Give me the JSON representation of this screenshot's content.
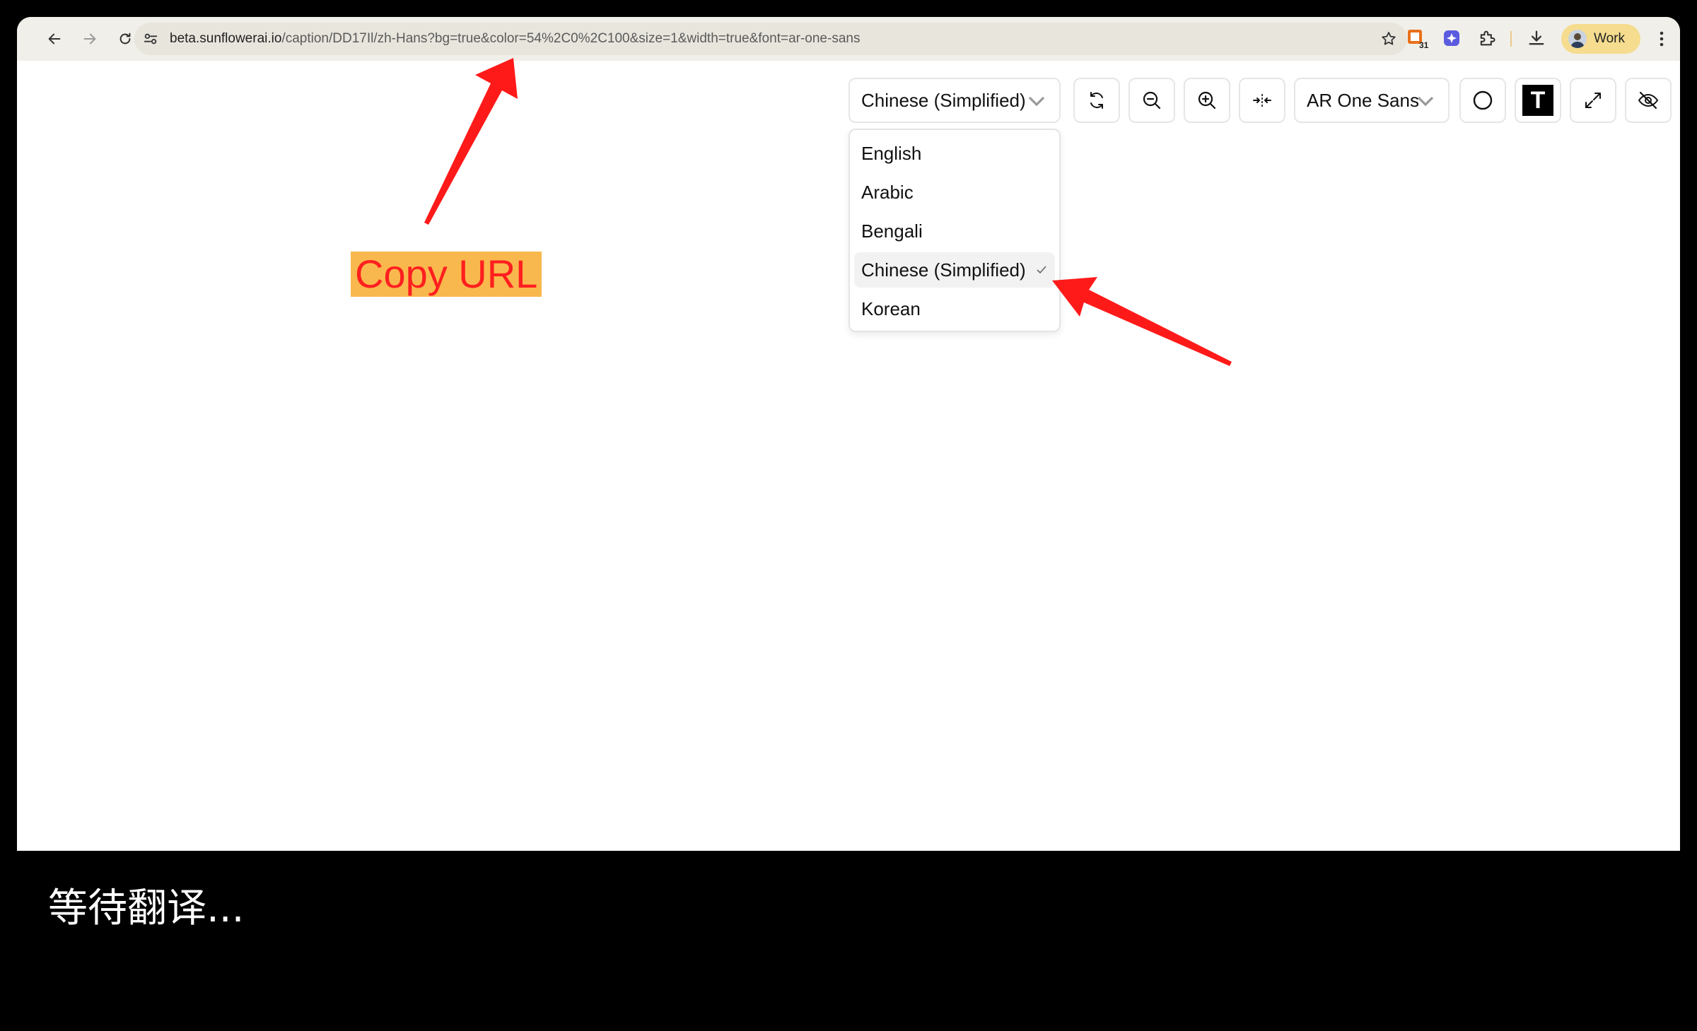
{
  "browser": {
    "url_host": "beta.sunflowerai.io",
    "url_path": "/caption/DD17Il/zh-Hans?bg=true&color=54%2C0%2C100&size=1&width=true&font=ar-one-sans",
    "extension_badge": "31",
    "profile_label": "Work"
  },
  "controls": {
    "language_select": "Chinese (Simplified)",
    "font_select": "AR One Sans",
    "text_style_label": "T"
  },
  "dropdown": {
    "options": [
      "English",
      "Arabic",
      "Bengali",
      "Chinese (Simplified)",
      "Korean"
    ],
    "selected": "Chinese (Simplified)"
  },
  "annotation": {
    "copy_url_label": "Copy URL",
    "arrow_color": "#ff1a1a",
    "label_bg": "#f9b84d"
  },
  "caption": {
    "text": "等待翻译..."
  }
}
